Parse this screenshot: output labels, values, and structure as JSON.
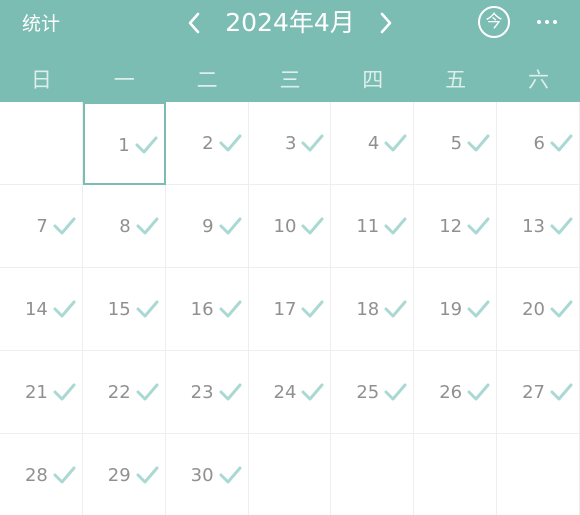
{
  "header": {
    "stats_label": "统计",
    "month_title": "2024年4月",
    "today_label": "今",
    "prev_icon": "chevron-left-icon",
    "next_icon": "chevron-right-icon",
    "more_icon": "more-horizontal-icon"
  },
  "weekdays": [
    "日",
    "一",
    "二",
    "三",
    "四",
    "五",
    "六"
  ],
  "calendar": {
    "first_weekday_offset": 1,
    "days_in_month": 30,
    "selected_day": 1,
    "checked_days": [
      1,
      2,
      3,
      4,
      5,
      6,
      7,
      8,
      9,
      10,
      11,
      12,
      13,
      14,
      15,
      16,
      17,
      18,
      19,
      20,
      21,
      22,
      23,
      24,
      25,
      26,
      27,
      28,
      29,
      30
    ]
  },
  "colors": {
    "header_bg": "#7bbcb3",
    "check": "#a9d9d2",
    "day_text": "#909090",
    "grid_line": "#eeeeee"
  }
}
